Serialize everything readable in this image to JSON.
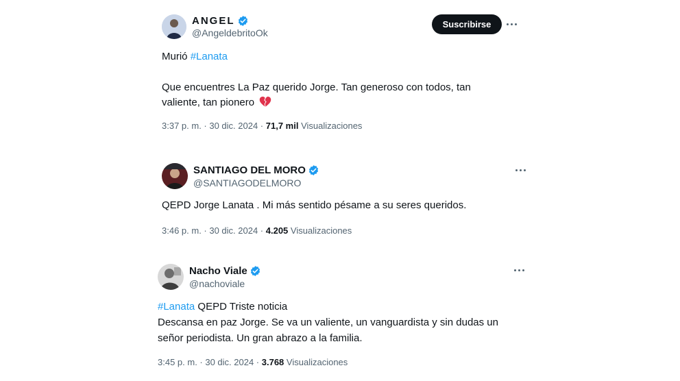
{
  "tweets": [
    {
      "name": "ANGEL",
      "handle": "@AngeldebritoOk",
      "subscribe_label": "Suscribirse",
      "line1_text": "Murió ",
      "line1_hashtag": "#Lanata",
      "line2": "Que encuentres La Paz querido Jorge. Tan generoso con todos, tan",
      "line3": "valiente, tan pionero",
      "emoji": "broken-heart-icon",
      "time": "3:37 p. m. · 30 dic. 2024 · ",
      "views": "71,7 mil",
      "views_label": " Visualizaciones"
    },
    {
      "name": "SANTIAGO DEL MORO",
      "handle": "@SANTIAGODELMORO",
      "line1": "QEPD  Jorge Lanata . Mi más sentido pésame a su seres queridos.",
      "time": "3:46 p. m. · 30 dic. 2024 · ",
      "views": "4.205",
      "views_label": " Visualizaciones"
    },
    {
      "name": "Nacho Viale",
      "handle": "@nachoviale",
      "line1_hashtag": "#Lanata",
      "line1_text": " QEPD Triste noticia",
      "line2": "Descansa en paz Jorge. Se va un valiente, un vanguardista y sin dudas un",
      "line3": "señor periodista. Un gran abrazo a la familia.",
      "time": "3:45 p. m. · 30 dic. 2024 · ",
      "views": "3.768",
      "views_label": " Visualizaciones"
    }
  ],
  "colors": {
    "text": "#0f1419",
    "secondary": "#536471",
    "accent": "#1d9bf0",
    "emoji": "#e0334c"
  }
}
